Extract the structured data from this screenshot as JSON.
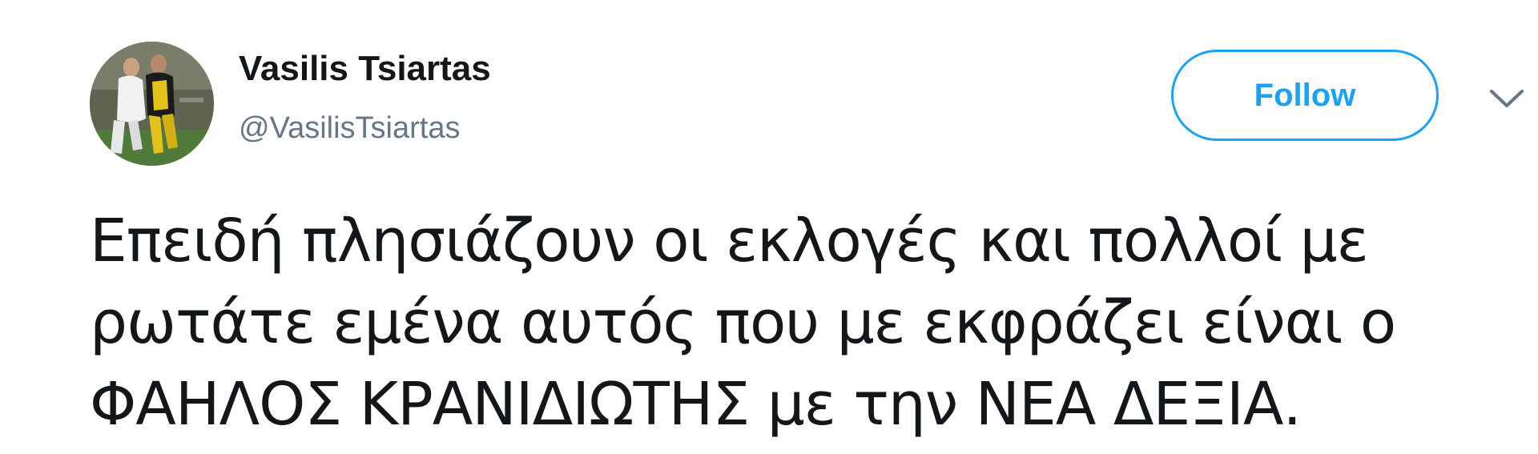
{
  "author": {
    "display_name": "Vasilis Tsiartas",
    "handle": "@VasilisTsiartas"
  },
  "actions": {
    "follow_label": "Follow"
  },
  "tweet": {
    "lines": [
      "Επειδή πλησιάζουν οι εκλογές και πολλοί με",
      "ρωτάτε εμένα αυτός που με εκφράζει είναι ο",
      "ΦΑΗΛΟΣ ΚΡΑΝΙΔΙΩΤΗΣ με την ΝΕΑ ΔΕΞΙΑ."
    ]
  },
  "icons": {
    "caret": "chevron-down-icon"
  },
  "colors": {
    "accent": "#1da1f2",
    "text": "#14171a",
    "secondary_text": "#657786"
  }
}
